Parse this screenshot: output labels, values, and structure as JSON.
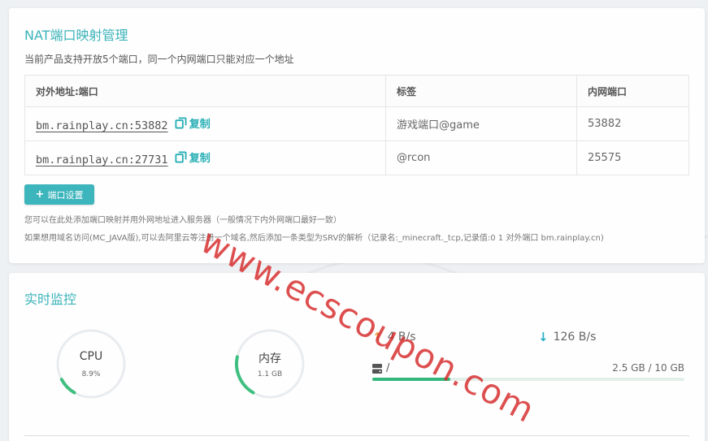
{
  "nat": {
    "title": "NAT端口映射管理",
    "subtitle": "当前产品支持开放5个端口，同一个内网端口只能对应一个地址",
    "columns": [
      "对外地址:端口",
      "标签",
      "内网端口"
    ],
    "rows": [
      {
        "address": "bm.rainplay.cn:53882",
        "copy_label": "复制",
        "tag": "游戏端口@game",
        "internal_port": "53882"
      },
      {
        "address": "bm.rainplay.cn:27731",
        "copy_label": "复制",
        "tag": "@rcon",
        "internal_port": "25575"
      }
    ],
    "port_button": {
      "icon": "+",
      "label": "端口设置"
    },
    "hint1": "您可以在此处添加端口映射并用外网地址进入服务器（一般情况下内外网端口最好一致）",
    "hint2": "如果想用域名访问(MC_JAVA版),可以去阿里云等注册一个域名,然后添加一条类型为SRV的解析（记录名:_minecraft._tcp,记录值:0 1 对外端口 bm.rainplay.cn)"
  },
  "monitor": {
    "title": "实时监控",
    "cpu": {
      "label": "CPU",
      "value": "8.9%",
      "fraction": 0.089
    },
    "memory": {
      "label": "内存",
      "value": "1.1 GB",
      "fraction": 0.2
    },
    "net_up": "4 B/s",
    "net_down": "126 B/s",
    "disk": {
      "path": "/",
      "usage": "2.5 GB / 10 GB",
      "fraction": 0.25
    }
  },
  "watermark": "www.ecscoupon.com",
  "colors": {
    "accent": "#3ab3b8",
    "gauge_green": "#3fbf7f",
    "upload": "#f0a04b",
    "download": "#2bb0c4",
    "watermark": "#d62828"
  }
}
